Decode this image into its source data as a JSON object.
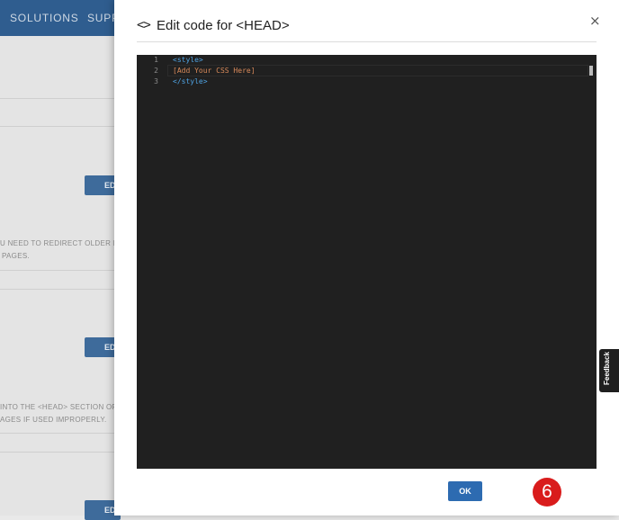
{
  "background": {
    "nav_items": [
      "SOLUTIONS",
      "SUPP"
    ],
    "button_fragments": [
      "ED",
      "ED",
      "ED"
    ],
    "text_fragments": [
      "U NEED TO REDIRECT OLDER LINKS",
      "PAGES.",
      "INTO THE <HEAD> SECTION OF EV",
      "AGES IF USED IMPROPERLY."
    ]
  },
  "modal": {
    "icon_glyph": "<>",
    "title": "Edit code for <HEAD>",
    "close_glyph": "×",
    "ok_label": "OK",
    "step_badge": "6"
  },
  "editor": {
    "lines": [
      {
        "num": "1",
        "code": "<style>"
      },
      {
        "num": "2",
        "code": "[Add Your CSS Here]"
      },
      {
        "num": "3",
        "code": "</style>"
      }
    ]
  },
  "feedback": {
    "label": "Feedback"
  },
  "colors": {
    "accent": "#2d6bb1",
    "badge": "#d91c1c",
    "editor_bg": "#202020"
  }
}
